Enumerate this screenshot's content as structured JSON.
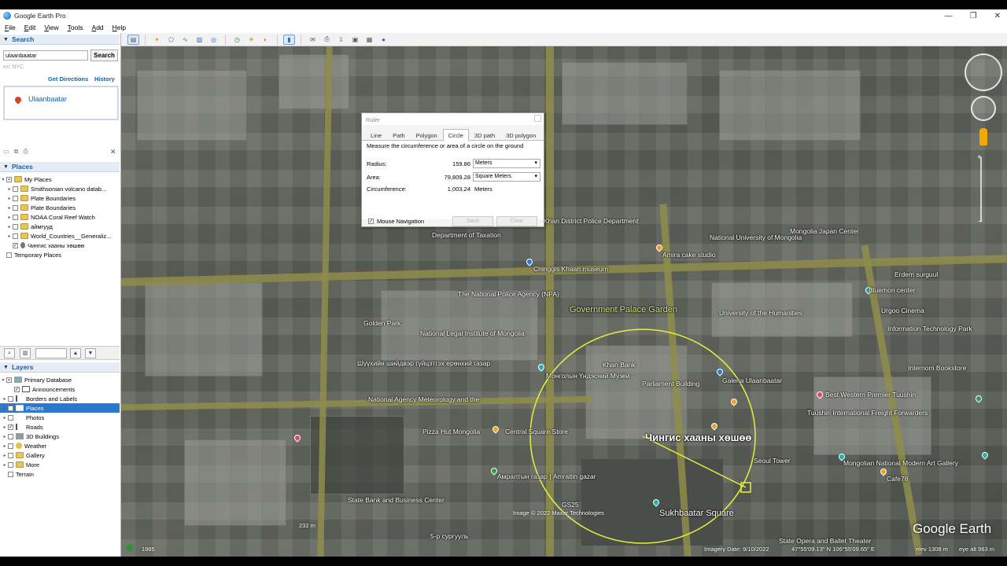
{
  "window": {
    "title": "Google Earth Pro",
    "controls": [
      "—",
      "❐",
      "✕"
    ]
  },
  "menu": [
    "File",
    "Edit",
    "View",
    "Tools",
    "Add",
    "Help"
  ],
  "search": {
    "header": "Search",
    "query": "ulaanbaatar",
    "button": "Search",
    "hint": "ex: NYC",
    "get_directions": "Get Directions",
    "history": "History",
    "result": "Ulaanbaatar"
  },
  "places": {
    "header": "Places",
    "items": [
      {
        "label": "My Places",
        "checked": true,
        "expanded": true
      },
      {
        "label": "Smithsonian volcano datab...",
        "checked": false
      },
      {
        "label": "Plate Boundaries",
        "checked": false
      },
      {
        "label": "Plate Boundaries",
        "checked": false
      },
      {
        "label": "NOAA Coral Reef Watch",
        "checked": false
      },
      {
        "label": "аймгууд",
        "checked": false
      },
      {
        "label": "World_Countries__Generaliz...",
        "checked": false
      },
      {
        "label": "Чингис хааны хөшөө",
        "checked": true
      },
      {
        "label": "Temporary Places",
        "checked": false
      }
    ]
  },
  "layers": {
    "header": "Layers",
    "items": [
      {
        "label": "Primary Database",
        "checked": true
      },
      {
        "label": "Announcements",
        "checked": true
      },
      {
        "label": "Borders and Labels",
        "checked": false
      },
      {
        "label": "Places",
        "checked": true,
        "selected": true
      },
      {
        "label": "Photos",
        "checked": false
      },
      {
        "label": "Roads",
        "checked": true
      },
      {
        "label": "3D Buildings",
        "checked": false
      },
      {
        "label": "Weather",
        "checked": false
      },
      {
        "label": "Gallery",
        "checked": false
      },
      {
        "label": "More",
        "checked": false
      },
      {
        "label": "Terrain",
        "checked": false
      }
    ]
  },
  "ruler": {
    "title": "Ruler",
    "tabs": [
      "Line",
      "Path",
      "Polygon",
      "Circle",
      "3D path",
      "3D polygon"
    ],
    "active_tab": "Circle",
    "description": "Measure the circumference or area of a circle on the ground",
    "radius_label": "Radius:",
    "radius_value": "159.86",
    "radius_unit": "Meters",
    "area_label": "Area:",
    "area_value": "79,809.28",
    "area_unit": "Square Meters",
    "circ_label": "Circumference:",
    "circ_value": "1,003.24",
    "circ_unit": "Meters",
    "mouse_nav": "Mouse Navigation",
    "save": "Save",
    "clear": "Clear"
  },
  "map_labels": [
    {
      "text": "Government Palace Garden",
      "style": "green"
    },
    {
      "text": "Чингис хааны хөшөө",
      "style": "huge"
    },
    {
      "text": "Sukhbaatar Square",
      "style": "big"
    },
    {
      "text": "Parliament Building",
      "style": ""
    },
    {
      "text": "Монголын Үндэсний Музей",
      "style": ""
    },
    {
      "text": "Khan Bank",
      "style": ""
    },
    {
      "text": "Galeria Ulaanbaatar",
      "style": ""
    },
    {
      "text": "Best Western Premier Tuushin",
      "style": ""
    },
    {
      "text": "Tuushin International Freight Forwarders",
      "style": ""
    },
    {
      "text": "Mongolian National Modern Art Gallery",
      "style": ""
    },
    {
      "text": "Cafe78",
      "style": ""
    },
    {
      "text": "Central Square Store",
      "style": ""
    },
    {
      "text": "Pizza Hut Mongolia",
      "style": ""
    },
    {
      "text": "Амралтын газар | Amraltin gazar",
      "style": ""
    },
    {
      "text": "State Bank and Business Center",
      "style": ""
    },
    {
      "text": "National Agency Meteorology and the",
      "style": ""
    },
    {
      "text": "National Legal Institute of Mongolia",
      "style": ""
    },
    {
      "text": "The National Police Agency (NPA)",
      "style": ""
    },
    {
      "text": "Chinggis Khaan museum",
      "style": ""
    },
    {
      "text": "Golden Park",
      "style": ""
    },
    {
      "text": "University of the Humanities",
      "style": ""
    },
    {
      "text": "Urgoo Cinema",
      "style": ""
    },
    {
      "text": "Information Technology Park",
      "style": ""
    },
    {
      "text": "Bluemon center",
      "style": ""
    },
    {
      "text": "Internom Bookstore",
      "style": ""
    },
    {
      "text": "National University of Mongolia",
      "style": ""
    },
    {
      "text": "Mongolia Japan Center",
      "style": ""
    },
    {
      "text": "Khan District Police Department",
      "style": ""
    },
    {
      "text": "Department of Taxation",
      "style": ""
    },
    {
      "text": "Amira cake studio",
      "style": ""
    },
    {
      "text": "Seoul Tower",
      "style": ""
    },
    {
      "text": "State Opera and Ballet Theater",
      "style": ""
    },
    {
      "text": "Шүүхийн шийдвэр гүйцэтгэх ерөнхий газар",
      "style": ""
    },
    {
      "text": "Erdem surguul",
      "style": ""
    },
    {
      "text": "GS25",
      "style": ""
    },
    {
      "text": "5-р сургууль",
      "style": ""
    }
  ],
  "status": {
    "year": "1985",
    "copyright": "Image © 2022 Maxar Technologies",
    "imagery_date": "Imagery Date: 9/10/2022",
    "coords": "47°55'09.13\" N  106°55'09.65\" E",
    "elev": "elev  1308 m",
    "eye": "eye alt  963 m",
    "scale": "232 m"
  },
  "brand": "Google Earth",
  "colors": {
    "accent": "#1a5fa8",
    "selection": "#2b78d0",
    "measure_circle": "#e6f03c"
  }
}
